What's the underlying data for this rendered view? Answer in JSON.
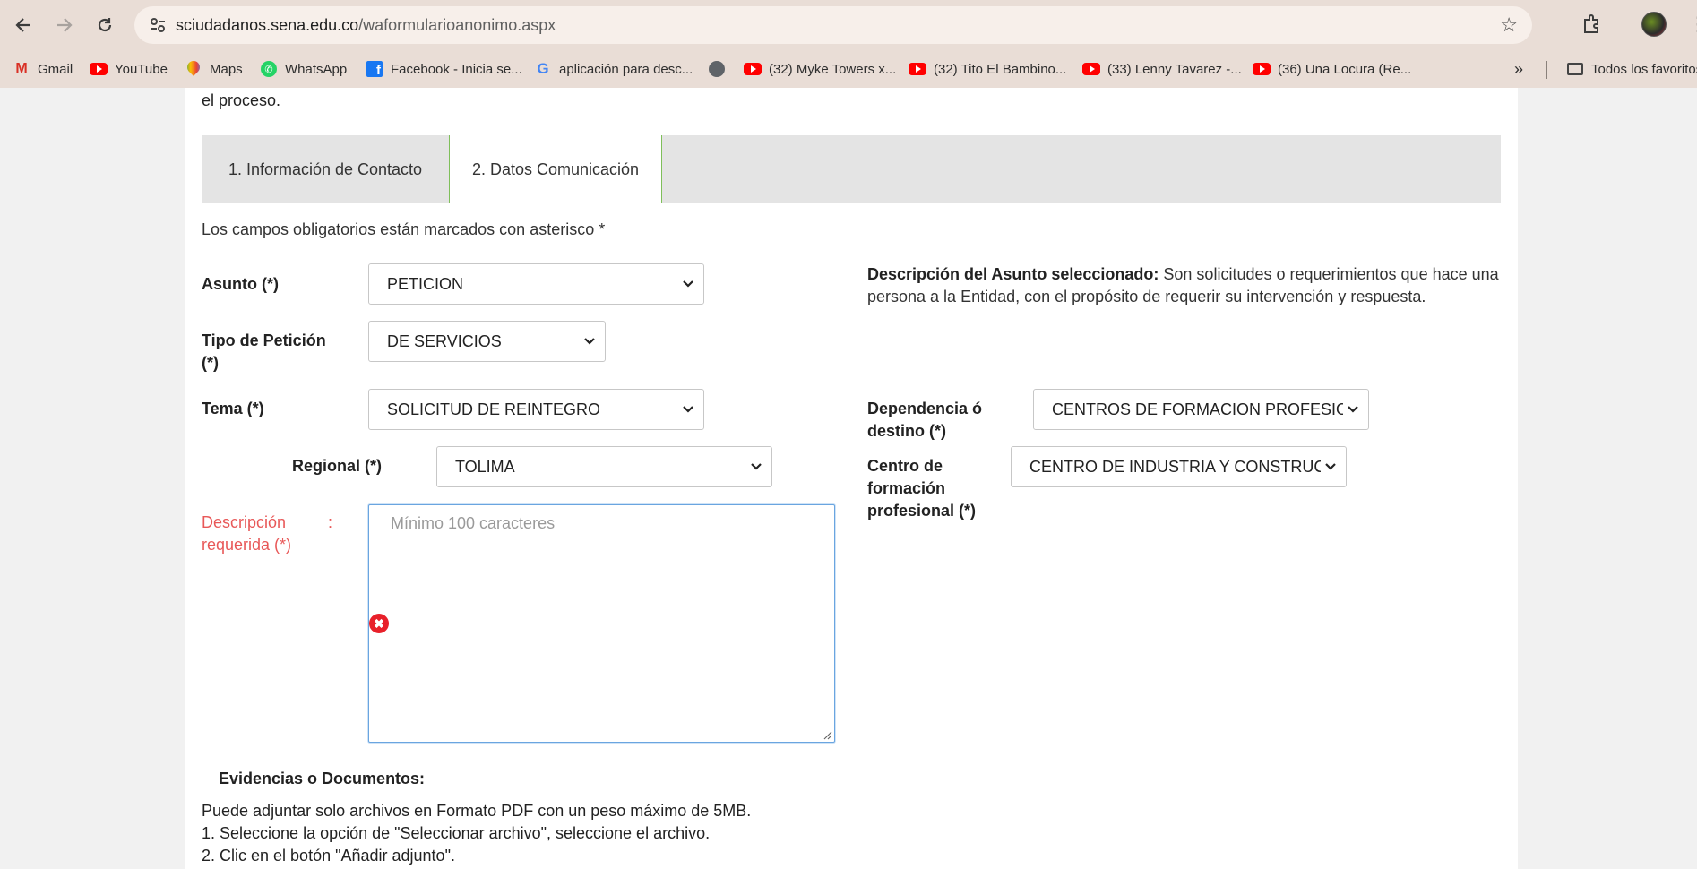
{
  "browser": {
    "url_host": "sciudadanos.sena.edu.co",
    "url_path": "/waformularioanonimo.aspx",
    "bookmarks": [
      {
        "label": "Gmail",
        "icon": "gmail-icon"
      },
      {
        "label": "YouTube",
        "icon": "youtube-icon"
      },
      {
        "label": "Maps",
        "icon": "maps-icon"
      },
      {
        "label": "WhatsApp",
        "icon": "whatsapp-icon"
      },
      {
        "label": "Facebook - Inicia se...",
        "icon": "facebook-icon"
      },
      {
        "label": "aplicación para desc...",
        "icon": "google-icon"
      },
      {
        "label": "",
        "icon": "globe-icon"
      },
      {
        "label": "(32) Myke Towers x...",
        "icon": "youtube-icon"
      },
      {
        "label": "(32) Tito El Bambino...",
        "icon": "youtube-icon"
      },
      {
        "label": "(33) Lenny Tavarez -...",
        "icon": "youtube-icon"
      },
      {
        "label": "(36) Una Locura (Re...",
        "icon": "youtube-icon"
      }
    ],
    "more_bookmarks": "»",
    "all_bookmarks_label": "Todos los favoritos"
  },
  "form": {
    "prev_text": "el proceso.",
    "tabs": [
      {
        "label": "1. Información de Contacto"
      },
      {
        "label": "2. Datos Comunicación"
      }
    ],
    "required_note": "Los campos obligatorios están marcados con asterisco *",
    "asunto": {
      "label": "Asunto (*)",
      "value": "PETICION"
    },
    "tipo_peticion": {
      "label": "Tipo de Petición (*)",
      "value": "DE SERVICIOS"
    },
    "tema": {
      "label": "Tema (*)",
      "value": "SOLICITUD DE REINTEGRO"
    },
    "regional": {
      "label": "Regional (*)",
      "value": "TOLIMA"
    },
    "descripcion": {
      "label": "Descripción requerida (*)",
      "colon": ":",
      "placeholder": "Mínimo 100 caracteres"
    },
    "asunto_help": {
      "title": "Descripción del Asunto seleccionado:",
      "text": " Son solicitudes o requerimientos que hace una persona a la Entidad, con el propósito de requerir su intervención y respuesta."
    },
    "dependencia": {
      "label": "Dependencia ó destino (*)",
      "value": "CENTROS DE FORMACION PROFESIONA"
    },
    "centro": {
      "label": "Centro de formación profesional (*)",
      "value": "CENTRO DE INDUSTRIA Y CONSTRUCCI"
    },
    "evidencias_title": "Evidencias o Documentos:",
    "info_lines": [
      "Puede adjuntar solo archivos en Formato PDF con un peso máximo de 5MB.",
      "1. Seleccione la opción de \"Seleccionar archivo\", seleccione el archivo.",
      "2. Clic en el botón \"Añadir adjunto\"."
    ]
  },
  "colors": {
    "error": "#e85858",
    "tab_accent": "#7fbf5a",
    "focus": "#6aa5e0"
  }
}
